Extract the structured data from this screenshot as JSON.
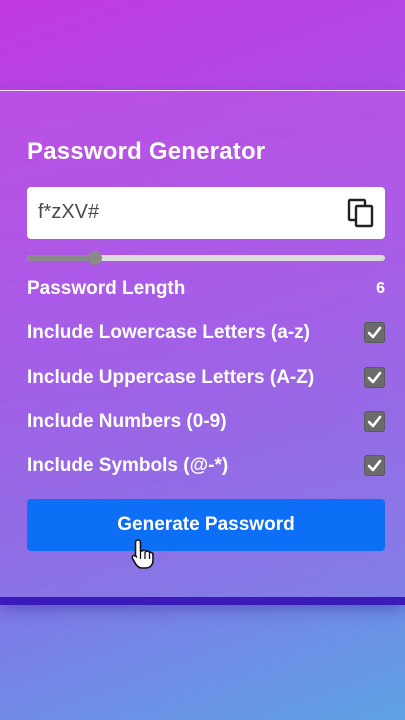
{
  "app": {
    "title": "Password Generator"
  },
  "password": {
    "value": "f*zXV#",
    "copy_icon": "copy-icon"
  },
  "length": {
    "label": "Password Length",
    "value": "6",
    "slider_fraction": 0.19
  },
  "options": [
    {
      "label": "Include Lowercase Letters (a-z)",
      "checked": true
    },
    {
      "label": "Include Uppercase Letters (A-Z)",
      "checked": true
    },
    {
      "label": "Include Numbers (0-9)",
      "checked": true
    },
    {
      "label": "Include Symbols (@-*)",
      "checked": true
    }
  ],
  "actions": {
    "generate_label": "Generate Password"
  },
  "colors": {
    "accent": "#0d6ef6",
    "checkbox": "#6b6b6b"
  }
}
